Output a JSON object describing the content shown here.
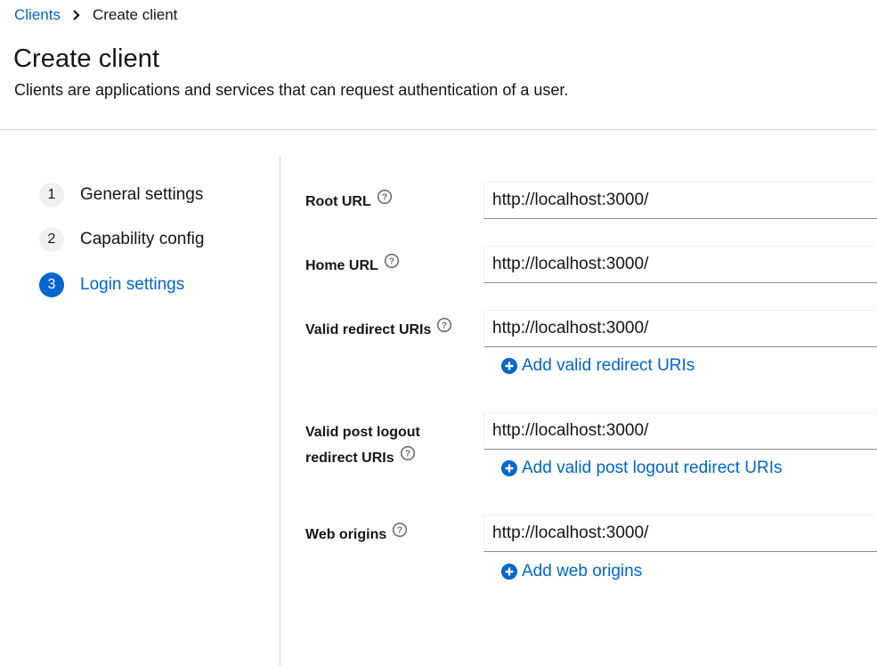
{
  "breadcrumb": {
    "parent": "Clients",
    "current": "Create client"
  },
  "header": {
    "title": "Create client",
    "description": "Clients are applications and services that can request authentication of a user."
  },
  "wizard": {
    "steps": [
      {
        "number": "1",
        "label": "General settings",
        "state": "completed"
      },
      {
        "number": "2",
        "label": "Capability config",
        "state": "completed"
      },
      {
        "number": "3",
        "label": "Login settings",
        "state": "current"
      }
    ]
  },
  "form": {
    "root_url": {
      "label": "Root URL",
      "value": "http://localhost:3000/"
    },
    "home_url": {
      "label": "Home URL",
      "value": "http://localhost:3000/"
    },
    "valid_redirect_uris": {
      "label": "Valid redirect URIs",
      "value": "http://localhost:3000/",
      "add_label": "Add valid redirect URIs"
    },
    "valid_post_logout_redirect_uris": {
      "label_line1": "Valid post logout",
      "label_line2": "redirect URIs",
      "value": "http://localhost:3000/",
      "add_label": "Add valid post logout redirect URIs"
    },
    "web_origins": {
      "label": "Web origins",
      "value": "http://localhost:3000/",
      "add_label": "Add web origins"
    }
  },
  "colors": {
    "link": "#0066cc",
    "text": "#151515",
    "divider": "#d2d2d2",
    "step_inactive_bg": "#f0f0f0",
    "help_icon": "#6a6e73"
  },
  "icons": {
    "breadcrumb_separator": "chevron-right-icon",
    "help": "help-circle-icon",
    "add": "plus-circle-icon"
  }
}
